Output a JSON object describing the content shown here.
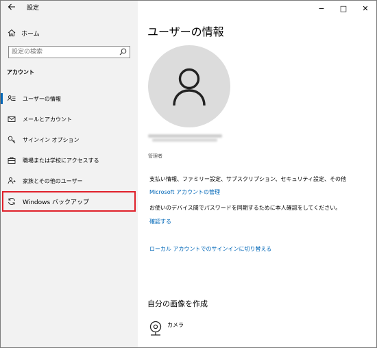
{
  "window": {
    "title": "設定",
    "controls": {
      "minimize": "−",
      "maximize": "□",
      "close": "✕"
    }
  },
  "sidebar": {
    "home_label": "ホーム",
    "search_placeholder": "設定の検索",
    "section_title": "アカウント",
    "items": [
      {
        "label": "ユーザーの情報",
        "icon": "user-info-icon",
        "selected": true
      },
      {
        "label": "メールとアカウント",
        "icon": "mail-icon"
      },
      {
        "label": "サインイン オプション",
        "icon": "key-icon"
      },
      {
        "label": "職場または学校にアクセスする",
        "icon": "briefcase-icon"
      },
      {
        "label": "家族とその他のユーザー",
        "icon": "people-icon"
      },
      {
        "label": "Windows バックアップ",
        "icon": "sync-icon",
        "highlighted": true
      }
    ]
  },
  "main": {
    "page_title": "ユーザーの情報",
    "account_role": "管理者",
    "billing_text": "支払い情報、ファミリー設定、サブスクリプション、セキュリティ設定、その他",
    "manage_account_link": "Microsoft アカウントの管理",
    "verify_text": "お使いのデバイス間でパスワードを同期するために本人確認をしてください。",
    "verify_link": "確認する",
    "switch_local_link": "ローカル アカウントでのサインインに切り替える",
    "create_picture_title": "自分の画像を作成",
    "camera_label": "カメラ"
  },
  "colors": {
    "accent": "#0067b8",
    "sidebar_bg": "#f2f2f2",
    "highlight": "#e0202a",
    "avatar_bg": "#dcdcdc"
  }
}
